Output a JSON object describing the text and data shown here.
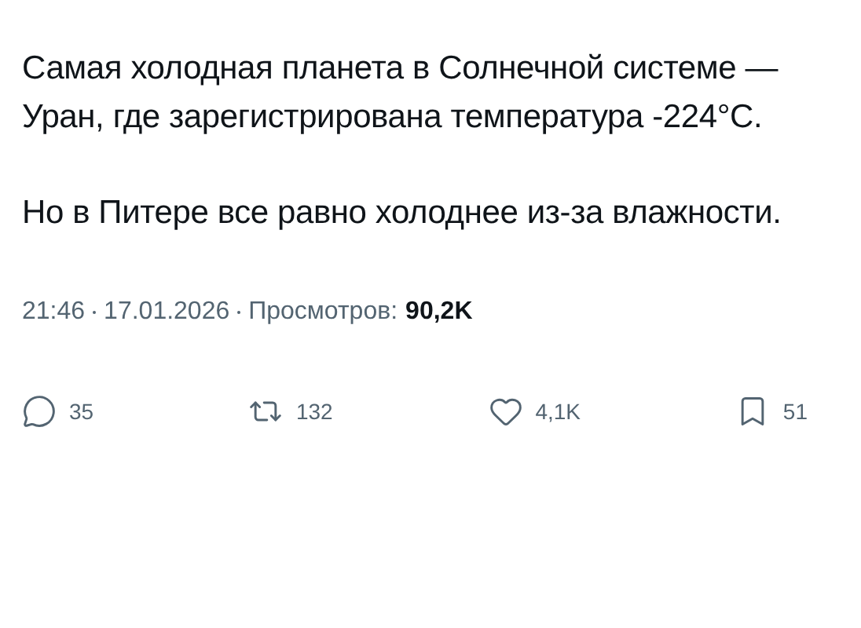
{
  "post": {
    "paragraphs": [
      "Самая холодная планета в Солнечной системе — Уран, где зарегистрирована температура -224°С.",
      "Но в Питере все равно холоднее из-за влажности."
    ],
    "meta": {
      "time": "21:46",
      "date": "17.01.2026",
      "views_label": "Просмотров:",
      "views": "90,2K"
    },
    "actions": [
      {
        "kind": "reply",
        "count": "35"
      },
      {
        "kind": "repost",
        "count": "132"
      },
      {
        "kind": "like",
        "count": "4,1K"
      },
      {
        "kind": "bookmark",
        "count": "51"
      }
    ]
  }
}
